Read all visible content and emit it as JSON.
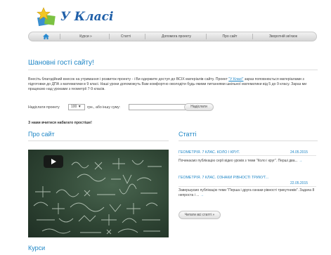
{
  "logo": {
    "text": "У Класі"
  },
  "nav": {
    "items": [
      "Курси »",
      "Статті",
      "Допомога проекту",
      "Про сайт",
      "Зворотній зв'язок"
    ]
  },
  "welcome": {
    "heading": "Шановні гості сайту!",
    "text_before": "Внесіть благодійний внесок на утримання і розвиток проекту - і Ви одержите доступ до ВСІХ матеріалів сайту. Проект ",
    "link": "\"У Класі\"",
    "text_after": " зараз поповнюється матеріалами з підготовки до ДПА з математики в 9 класі. Наші уроки допоможуть Вам комфортно оволодіти будь-якими питаннями шкільної математики від 5 до 9 класу. Зараз ми працюємо над уроками з геометрії 7-9 класів."
  },
  "donate": {
    "label": "Надіслати проекту",
    "amount": "100 ▼",
    "middle": "грн.,  або іншу суму:",
    "input_value": "",
    "button": "Надіслати"
  },
  "note": "З нами вчитися набагато простіше!",
  "about": {
    "heading": "Про сайт"
  },
  "articles": {
    "heading": "Статті",
    "items": [
      {
        "title": "ГЕОМЕТРІЯ. 7 КЛАС. КОЛО І КРУГ.",
        "date": "24.05.2015",
        "text": "Починаємо публікацію серії відео уроків з теми \"Коло і круг\". Перші два...",
        "more": "→"
      },
      {
        "title": "ГЕОМЕТРІЯ. 7 КЛАС. ОЗНАКИ РІВНОСТІ ТРИКУТ...",
        "date": "22.05.2015",
        "text": "Завершуємо публікацію теми \"Перша і друга ознаки рівності трикутників\". Задача 8 непроста і ...",
        "more": "→"
      }
    ],
    "read_all": "Читати всі статті »"
  },
  "courses": {
    "heading": "Курси"
  },
  "colors": {
    "accent": "#1e86c6",
    "logo": "#1f5fa8",
    "board": "#2f4534"
  },
  "icons": {
    "home": "home-icon",
    "play": "play-icon",
    "logo": "star-book-icon"
  }
}
